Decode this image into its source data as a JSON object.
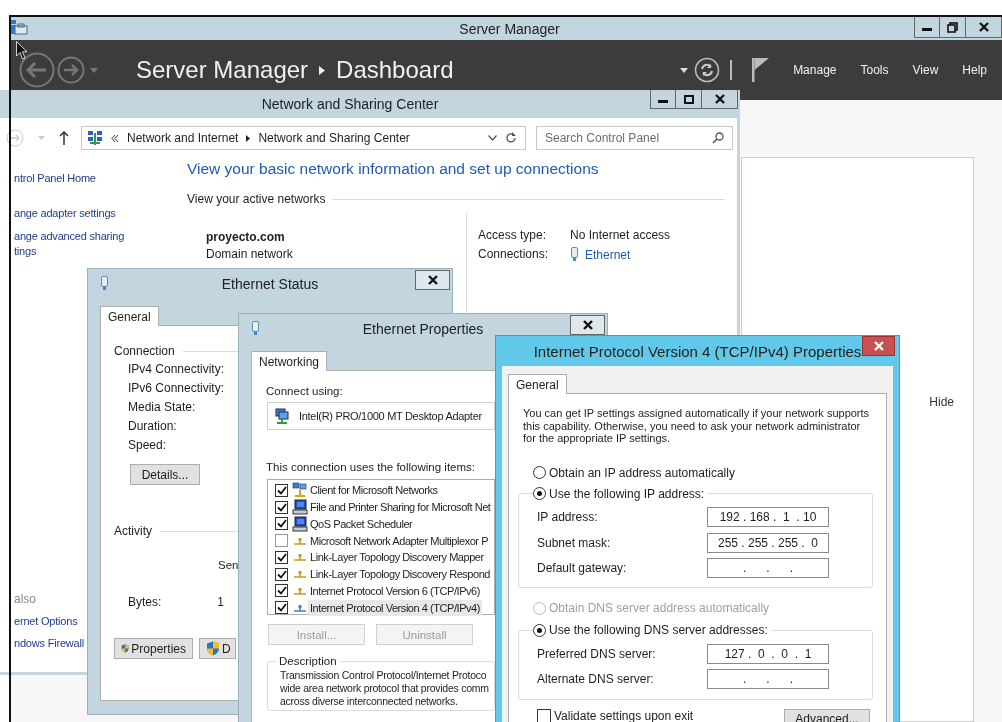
{
  "server_manager": {
    "title": "Server Manager",
    "breadcrumb": [
      "Server Manager",
      "Dashboard"
    ],
    "menu": [
      "Manage",
      "Tools",
      "View",
      "Help"
    ],
    "hide_label": "Hide"
  },
  "network_center": {
    "title": "Network and Sharing Center",
    "address_path": [
      "Network and Internet",
      "Network and Sharing Center"
    ],
    "search": {
      "placeholder": "Search Control Panel"
    },
    "nav_links": [
      "ntrol Panel Home",
      "ange adapter settings",
      "ange advanced sharing\ntings"
    ],
    "see_also_heading": "also",
    "see_also": [
      "ernet Options",
      "ndows Firewall"
    ],
    "heading": "View your basic network information and set up connections",
    "active_networks_label": "View your active networks",
    "network": {
      "name": "proyecto.com",
      "category": "Domain network"
    },
    "access_type_label": "Access type:",
    "access_type": "No Internet access",
    "connections_label": "Connections:",
    "connection": "Ethernet"
  },
  "ethernet_status": {
    "title": "Ethernet Status",
    "tabs": [
      {
        "label": "General",
        "selected": true
      }
    ],
    "connection_label": "Connection",
    "fields": [
      "IPv4 Connectivity:",
      "IPv6 Connectivity:",
      "Media State:",
      "Duration:",
      "Speed:"
    ],
    "details_button": "Details...",
    "activity_label": "Activity",
    "sent_label": "Sen",
    "bytes_label": "Bytes:",
    "bytes_value": "1",
    "buttons": [
      "Properties",
      "D"
    ]
  },
  "ethernet_properties": {
    "title": "Ethernet Properties",
    "tabs": [
      {
        "label": "Networking",
        "selected": true
      }
    ],
    "connect_using_label": "Connect using:",
    "adapter": "Intel(R) PRO/1000 MT Desktop Adapter",
    "items_label": "This connection uses the following items:",
    "items": [
      {
        "label": "Client for Microsoft Networks",
        "checked": true,
        "selected": false,
        "kind": "client"
      },
      {
        "label": "File and Printer Sharing for Microsoft Net",
        "checked": true,
        "selected": false,
        "kind": "service"
      },
      {
        "label": "QoS Packet Scheduler",
        "checked": true,
        "selected": false,
        "kind": "service"
      },
      {
        "label": "Microsoft Network Adapter Multiplexor P",
        "checked": false,
        "selected": false,
        "kind": "protocol"
      },
      {
        "label": "Link-Layer Topology Discovery Mapper",
        "checked": true,
        "selected": false,
        "kind": "protocol"
      },
      {
        "label": "Link-Layer Topology Discovery Respond",
        "checked": true,
        "selected": false,
        "kind": "protocol"
      },
      {
        "label": "Internet Protocol Version 6 (TCP/IPv6)",
        "checked": true,
        "selected": false,
        "kind": "protocol"
      },
      {
        "label": "Internet Protocol Version 4 (TCP/IPv4)",
        "checked": true,
        "selected": true,
        "kind": "protocol"
      }
    ],
    "buttons": [
      {
        "label": "Install...",
        "disabled": true
      },
      {
        "label": "Uninstall",
        "disabled": true
      }
    ],
    "description_label": "Description",
    "description": [
      "Transmission Control Protocol/Internet Protoco",
      "wide area network protocol that provides comm",
      "across diverse interconnected networks."
    ]
  },
  "ipv4_properties": {
    "title": "Internet Protocol Version 4 (TCP/IPv4) Properties",
    "tabs": [
      {
        "label": "General",
        "selected": true
      }
    ],
    "intro": "You can get IP settings assigned automatically if your network supports this capability. Otherwise, you need to ask your network administrator for the appropriate IP settings.",
    "ip_auto": {
      "label": "Obtain an IP address automatically",
      "selected": false,
      "disabled": false
    },
    "ip_manual": {
      "label": "Use the following IP address:",
      "selected": true,
      "disabled": false
    },
    "ip_fields": [
      {
        "label": "IP address:",
        "value": "192 . 168 .  1  . 10"
      },
      {
        "label": "Subnet mask:",
        "value": "255 . 255 . 255 .  0"
      },
      {
        "label": "Default gateway:",
        "value": ".      .      ."
      }
    ],
    "dns_auto": {
      "label": "Obtain DNS server address automatically",
      "selected": false,
      "disabled": true
    },
    "dns_manual": {
      "label": "Use the following DNS server addresses:",
      "selected": true,
      "disabled": false
    },
    "dns_fields": [
      {
        "label": "Preferred DNS server:",
        "value": "127 .  0  .  0  .  1"
      },
      {
        "label": "Alternate DNS server:",
        "value": ".      .      ."
      }
    ],
    "validate": {
      "label": "Validate settings upon exit",
      "checked": false
    },
    "advanced_button": "Advanced..."
  }
}
